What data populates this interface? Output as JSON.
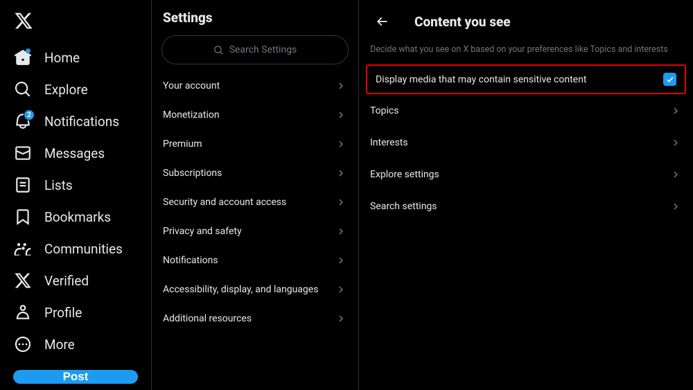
{
  "nav": {
    "items": [
      {
        "label": "Home",
        "icon": "home",
        "dot": true
      },
      {
        "label": "Explore",
        "icon": "search"
      },
      {
        "label": "Notifications",
        "icon": "bell",
        "badge": "2"
      },
      {
        "label": "Messages",
        "icon": "mail"
      },
      {
        "label": "Lists",
        "icon": "list"
      },
      {
        "label": "Bookmarks",
        "icon": "bookmark"
      },
      {
        "label": "Communities",
        "icon": "communities"
      },
      {
        "label": "Verified",
        "icon": "x"
      },
      {
        "label": "Profile",
        "icon": "profile"
      },
      {
        "label": "More",
        "icon": "more"
      }
    ],
    "post_label": "Post"
  },
  "settings": {
    "title": "Settings",
    "search_placeholder": "Search Settings",
    "items": [
      "Your account",
      "Monetization",
      "Premium",
      "Subscriptions",
      "Security and account access",
      "Privacy and safety",
      "Notifications",
      "Accessibility, display, and languages",
      "Additional resources"
    ]
  },
  "content": {
    "title": "Content you see",
    "description": "Decide what you see on X based on your preferences like Topics and interests",
    "sensitive_label": "Display media that may contain sensitive content",
    "sensitive_checked": true,
    "items": [
      "Topics",
      "Interests",
      "Explore settings",
      "Search settings"
    ]
  }
}
